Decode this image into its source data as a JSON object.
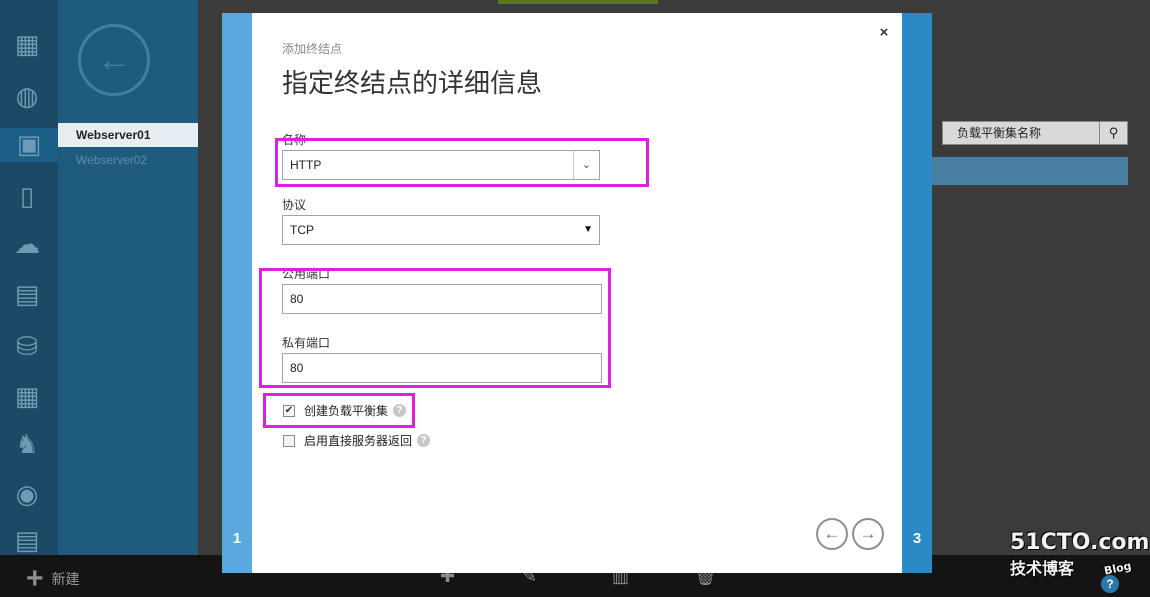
{
  "background": {
    "items": [
      "Webserver01",
      "Webserver02"
    ],
    "search_placeholder": "负载平衡集名称",
    "bottom_bar": {
      "new_label": "新建"
    }
  },
  "watermark": {
    "line1": "51CTO.com",
    "line2": "技术博客",
    "blog": "Blog"
  },
  "wizard": {
    "subtitle": "添加终结点",
    "title": "指定终结点的详细信息",
    "close_symbol": "×",
    "step_left": "1",
    "step_right": "3",
    "fields": {
      "name_label": "名称",
      "name_value": "HTTP",
      "protocol_label": "协议",
      "protocol_value": "TCP",
      "public_port_label": "公用端口",
      "public_port_value": "80",
      "private_port_label": "私有端口",
      "private_port_value": "80"
    },
    "checkboxes": [
      {
        "label": "创建负载平衡集",
        "checked": true
      },
      {
        "label": "启用直接服务器返回",
        "checked": false
      }
    ],
    "nav": {
      "back_symbol": "←",
      "next_symbol": "→"
    }
  },
  "colors": {
    "accent_left": "#5aa8dd",
    "accent_right": "#2b8ac6",
    "annotation": "#e020e0"
  }
}
